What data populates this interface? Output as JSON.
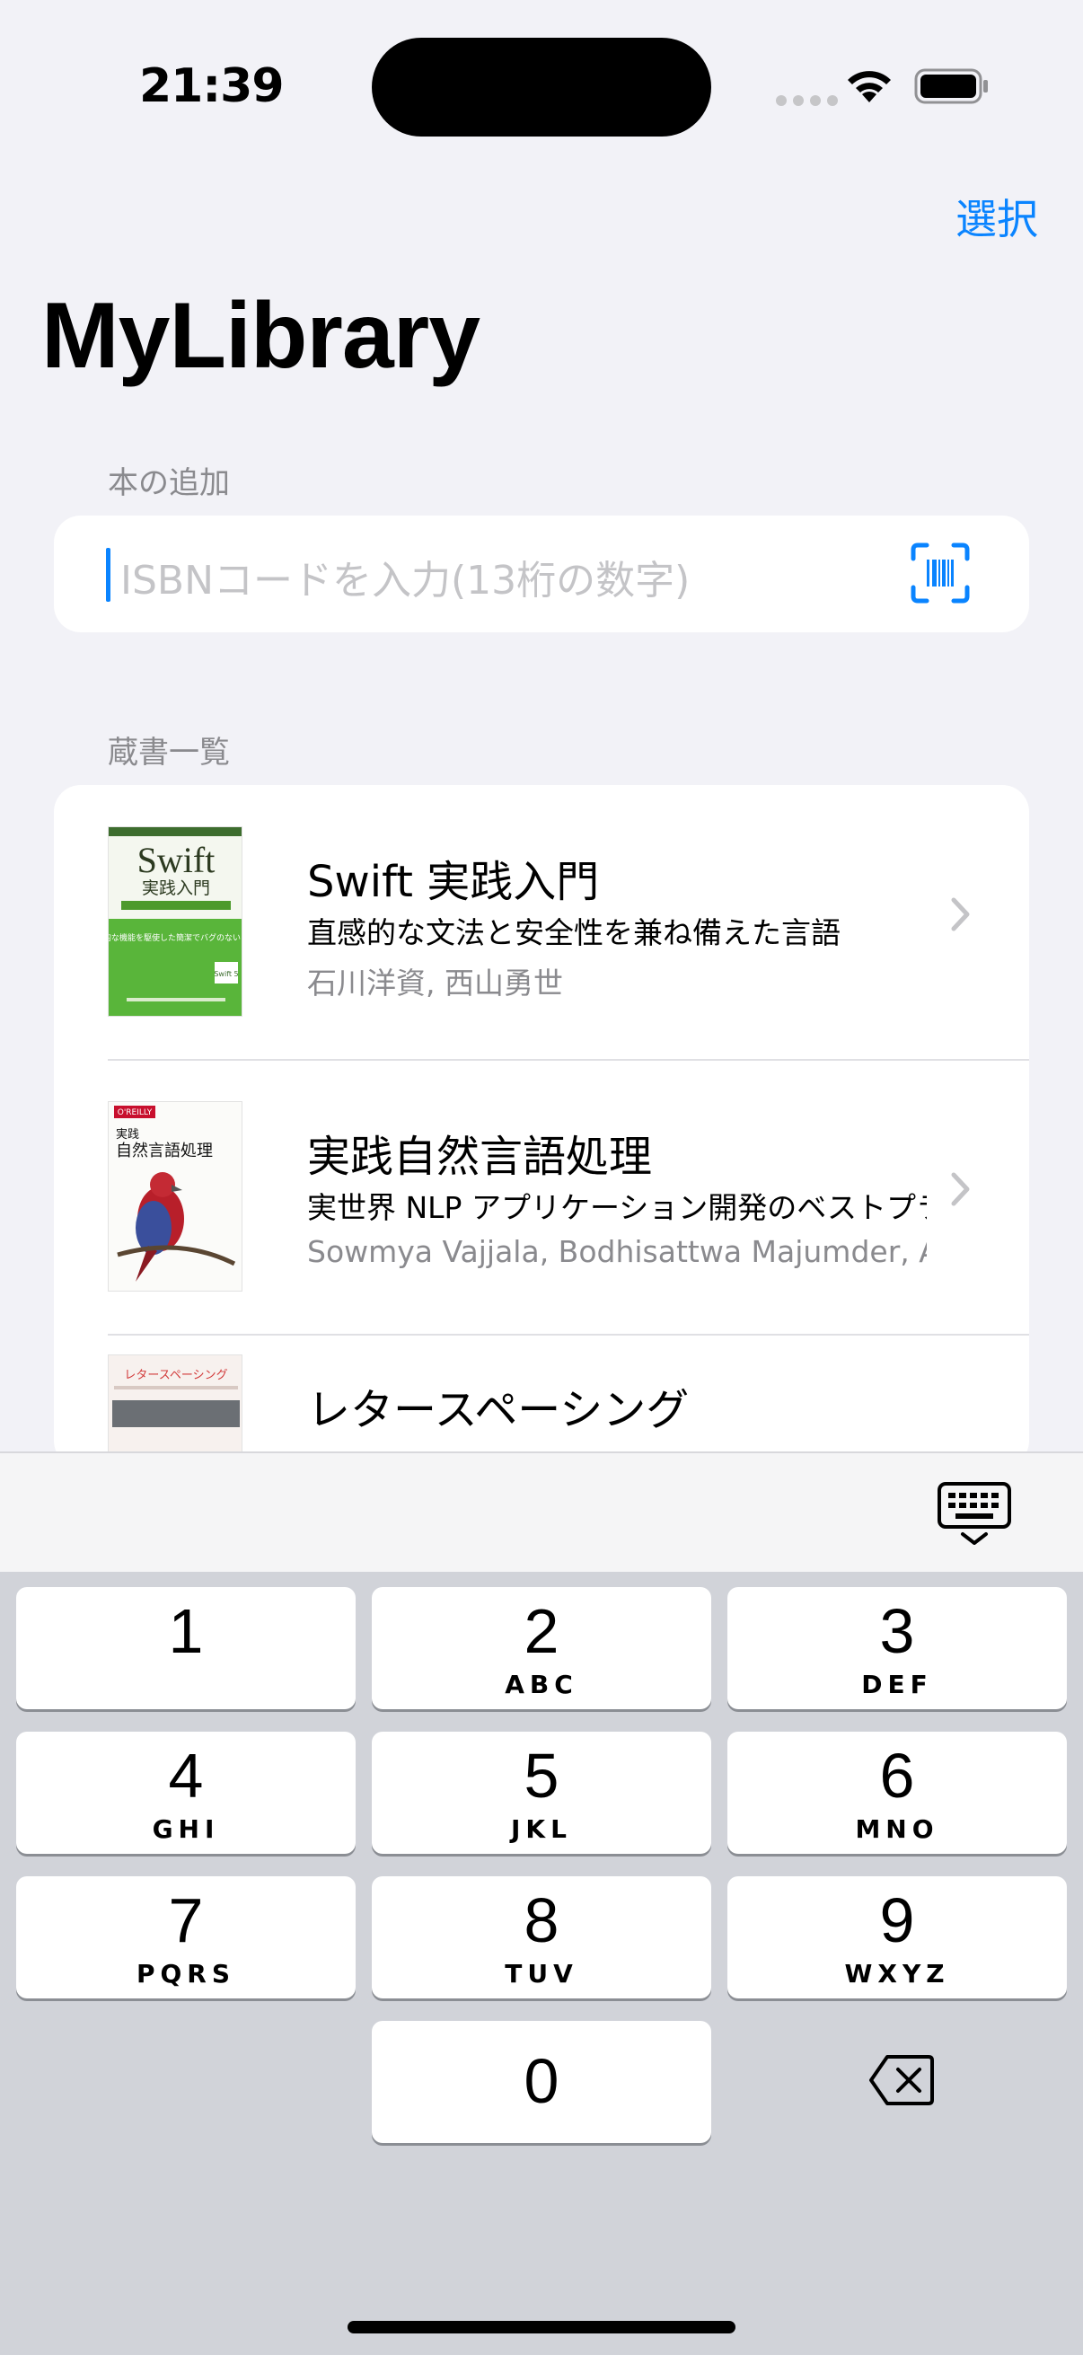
{
  "status_bar": {
    "time": "21:39"
  },
  "nav": {
    "select_label": "選択",
    "title": "MyLibrary"
  },
  "add_section": {
    "header": "本の追加",
    "placeholder": "ISBNコードを入力(13桁の数字)"
  },
  "library_section": {
    "header": "蔵書一覧",
    "books": [
      {
        "title": "Swift 実践入門",
        "subtitle": "直感的な文法と安全性を兼ね備えた言語",
        "author": "石川洋資, 西山勇世",
        "cover": {
          "line1": "Swift",
          "line2": "実践入門",
          "body": "実践的な機能を駆使した簡潔でバグのないコード",
          "badge": "Swift 5"
        }
      },
      {
        "title": "実践自然言語処理",
        "subtitle": "実世界 NLP アプリケーション開発のベストプラクティス",
        "author": "Sowmya Vajjala, Bodhisattwa Majumder, Anuj Gupta, Harshit Surana",
        "cover": {
          "publisher": "O'REILLY",
          "line1": "実践",
          "line2": "自然言語処理"
        }
      },
      {
        "title": "レタースペーシング",
        "subtitle": "",
        "author": "",
        "cover": {
          "line1": "レタースペーシング"
        }
      }
    ]
  },
  "keyboard": {
    "keys": [
      {
        "num": "1",
        "letters": ""
      },
      {
        "num": "2",
        "letters": "ABC"
      },
      {
        "num": "3",
        "letters": "DEF"
      },
      {
        "num": "4",
        "letters": "GHI"
      },
      {
        "num": "5",
        "letters": "JKL"
      },
      {
        "num": "6",
        "letters": "MNO"
      },
      {
        "num": "7",
        "letters": "PQRS"
      },
      {
        "num": "8",
        "letters": "TUV"
      },
      {
        "num": "9",
        "letters": "WXYZ"
      },
      {
        "num": "0",
        "letters": ""
      }
    ]
  },
  "colors": {
    "accent": "#0a84ff",
    "background": "#f2f2f7",
    "keyboard": "#d1d3d9"
  }
}
